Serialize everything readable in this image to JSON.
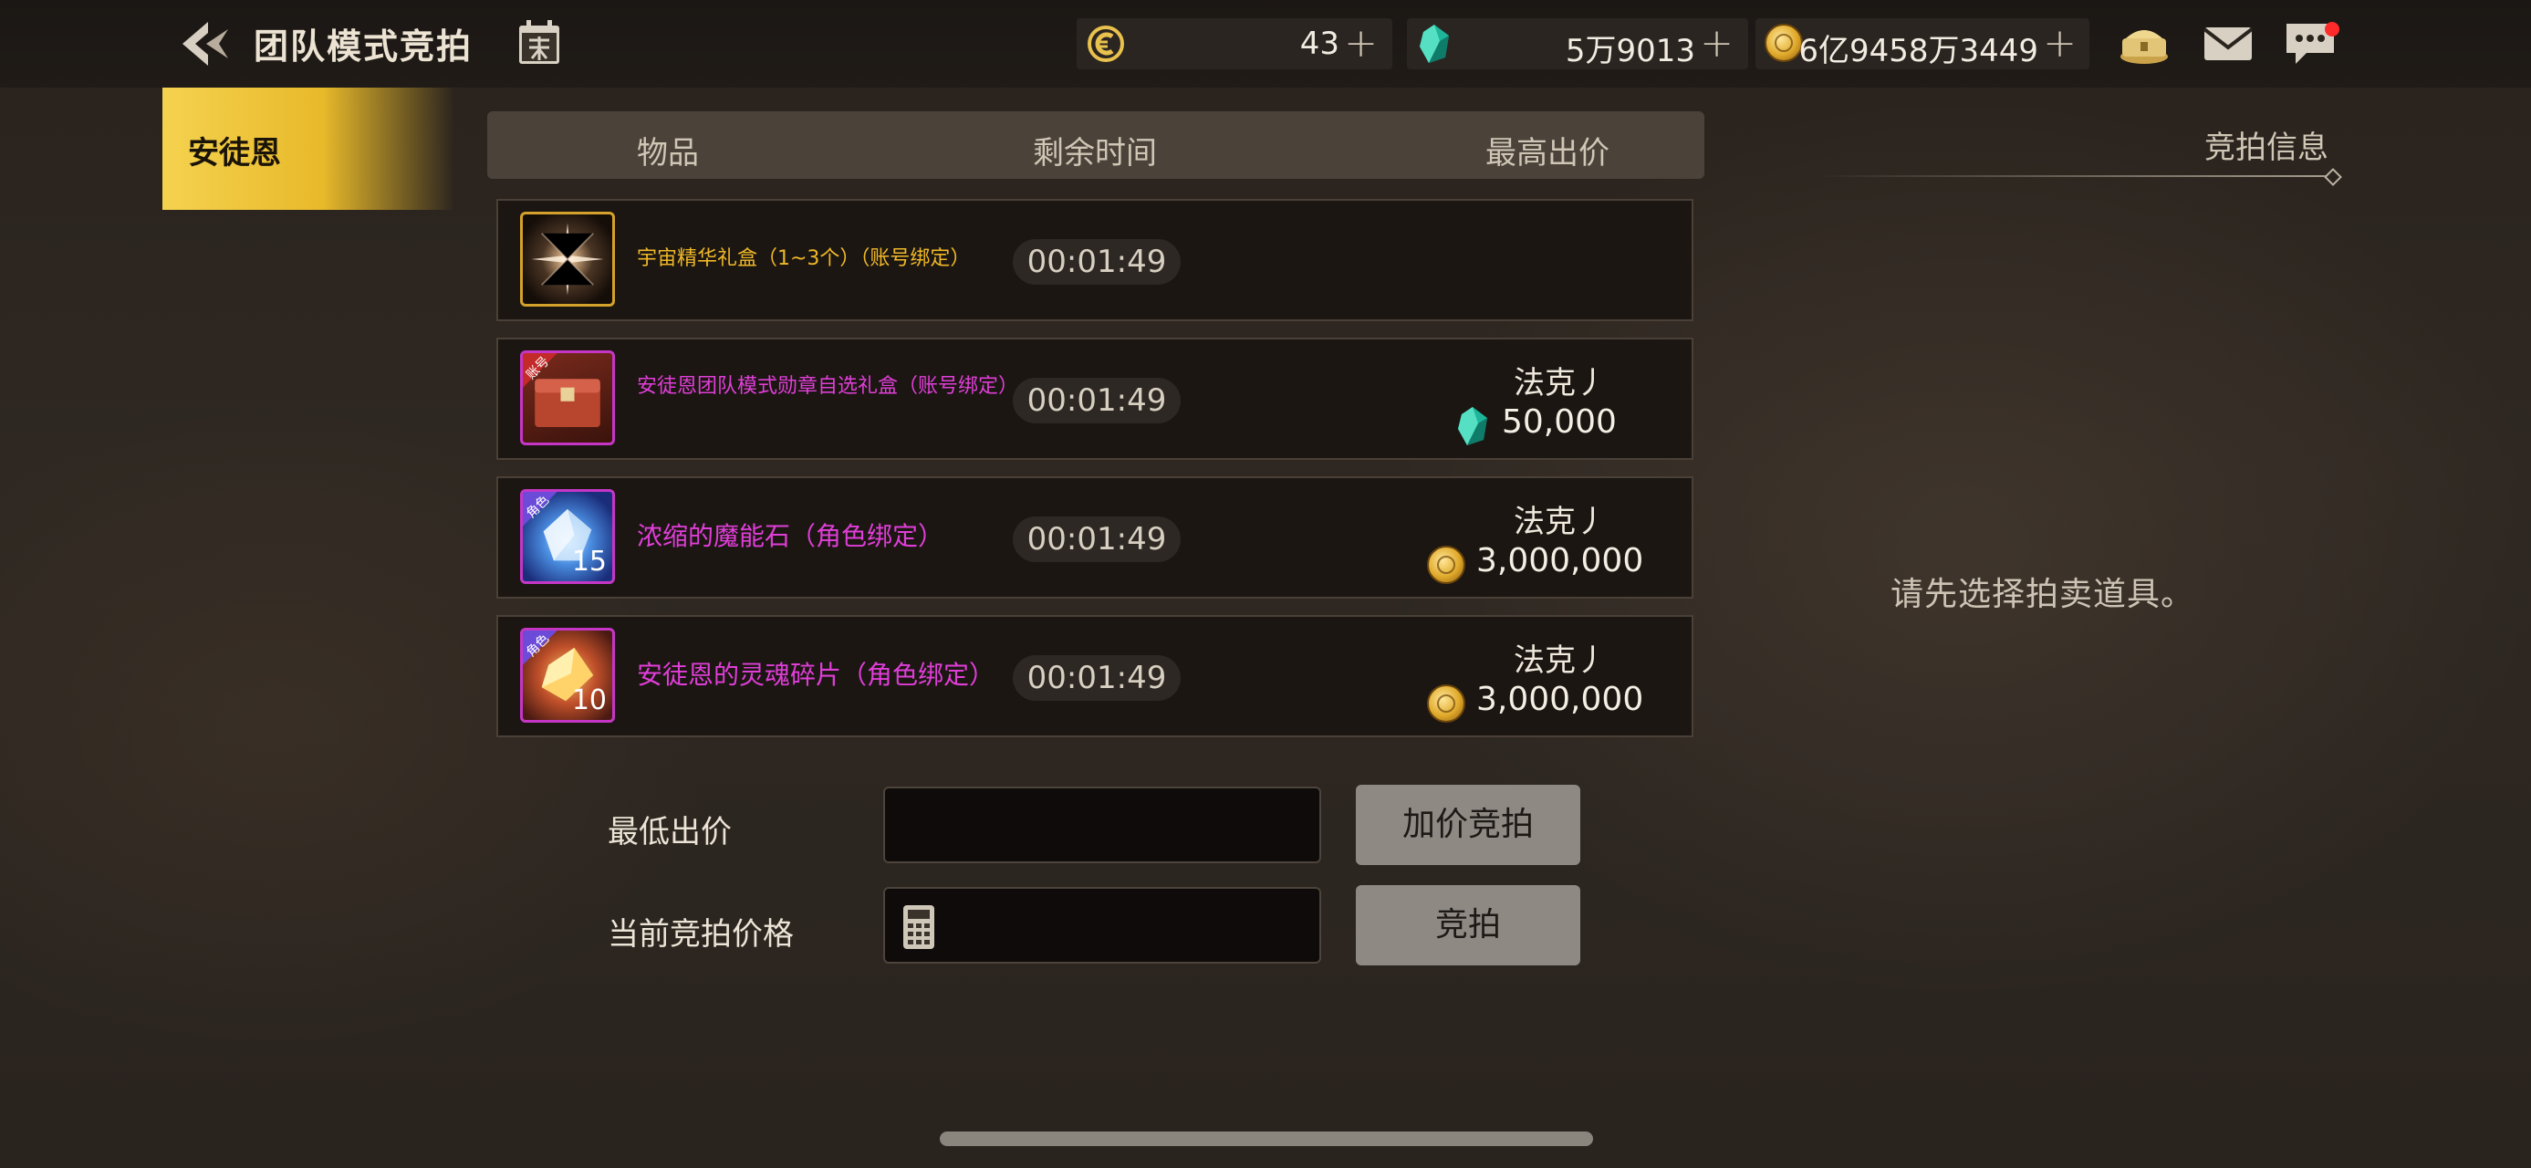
{
  "header": {
    "title": "团队模式竞拍",
    "calendar_icon": "calendar-icon",
    "currencies": [
      {
        "icon": "c-coin-icon",
        "value": "43"
      },
      {
        "icon": "green-gem-icon",
        "value": "5万9013"
      },
      {
        "icon": "gold-coin-icon",
        "value": "6亿9458万3449"
      }
    ],
    "plus_glyph": "+"
  },
  "sidebar": {
    "tabs": [
      {
        "label": "安徒恩",
        "selected": true
      }
    ]
  },
  "table": {
    "columns": [
      "物品",
      "剩余时间",
      "最高出价"
    ],
    "rows": [
      {
        "name": "宇宙精华礼盒（1~3个）（账号绑定）",
        "name_color": "#f0b828",
        "time": "00:01:49",
        "bidder": "",
        "amount": "",
        "currency": "",
        "icon": "cosmic-essence-box-icon",
        "icon_badge": "",
        "icon_count": ""
      },
      {
        "name": "安徒恩团队模式勋章自选礼盒（账号绑定）",
        "name_color": "#e03ed8",
        "time": "00:01:49",
        "bidder": "法克丿",
        "amount": "50,000",
        "currency": "green-gem-icon",
        "icon": "medal-chest-icon",
        "icon_badge": "账号",
        "icon_count": ""
      },
      {
        "name": "浓缩的魔能石（角色绑定）",
        "name_color": "#e03ed8",
        "time": "00:01:49",
        "bidder": "法克丿",
        "amount": "3,000,000",
        "currency": "gold-coin-icon",
        "icon": "magic-stone-icon",
        "icon_badge": "角色",
        "icon_count": "15"
      },
      {
        "name": "安徒恩的灵魂碎片（角色绑定）",
        "name_color": "#e03ed8",
        "time": "00:01:49",
        "bidder": "法克丿",
        "amount": "3,000,000",
        "currency": "gold-coin-icon",
        "icon": "soul-fragment-icon",
        "icon_badge": "角色",
        "icon_count": "10"
      }
    ]
  },
  "bid_form": {
    "min_bid_label": "最低出价",
    "current_bid_label": "当前竞拍价格",
    "raise_button": "加价竞拍",
    "bid_button": "竞拍",
    "min_bid_value": "",
    "current_bid_value": ""
  },
  "info_panel": {
    "title": "竞拍信息",
    "empty_message": "请先选择拍卖道具。"
  },
  "colors": {
    "accent_gold": "#f2c94c",
    "rare_name": "#e03ed8",
    "epic_name": "#f0b828",
    "button_gray": "#8e8983"
  }
}
